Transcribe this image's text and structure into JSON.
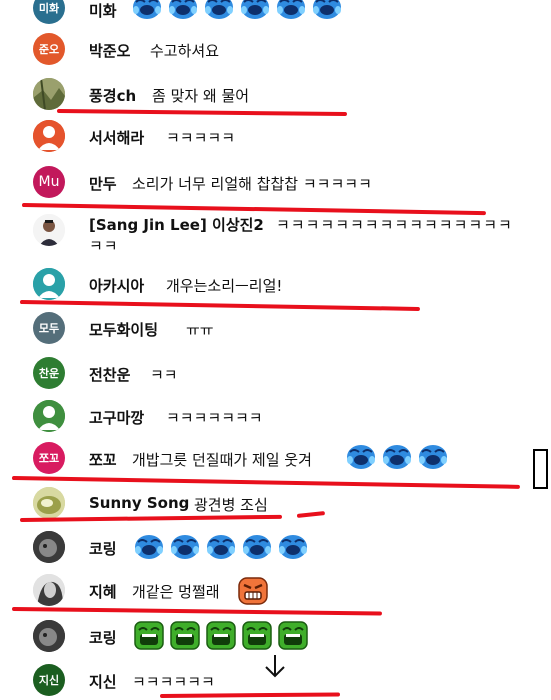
{
  "messages": [
    {
      "avatar_text": "미화",
      "name": "미화",
      "text": ""
    },
    {
      "avatar_text": "준오",
      "name": "박준오",
      "text": "수고하셔요"
    },
    {
      "avatar_text": "",
      "name": "풍경ch",
      "text": "좀 맞자 왜 물어"
    },
    {
      "avatar_text": "",
      "name": "서서해라",
      "text": "ㅋㅋㅋㅋㅋ"
    },
    {
      "avatar_text": "Mu",
      "name": "만두",
      "text": "소리가 너무 리얼해 찹찹찹 ㅋㅋㅋㅋㅋ"
    },
    {
      "avatar_text": "",
      "name": "[Sang Jin Lee] 이상진2",
      "text": "ㅋㅋㅋㅋㅋㅋㅋㅋㅋㅋㅋㅋㅋㅋㅋㅋ",
      "text_cont": "ㅋㅋ"
    },
    {
      "avatar_text": "",
      "name": "아카시아",
      "text": "개우는소리ㅡ리얼!"
    },
    {
      "avatar_text": "모두",
      "name": "모두화이팅",
      "text": "ㅠㅠ"
    },
    {
      "avatar_text": "찬운",
      "name": "전찬운",
      "text": "ㅋㅋ"
    },
    {
      "avatar_text": "",
      "name": "고구마깡",
      "text": "ㅋㅋㅋㅋㅋㅋㅋ"
    },
    {
      "avatar_text": "쪼꼬",
      "name": "쪼꼬",
      "text": "개밥그릇 던질때가 제일 웃겨"
    },
    {
      "avatar_text": "",
      "name": "Sunny Song",
      "text": "광견병 조심"
    },
    {
      "avatar_text": "",
      "name": "코링",
      "text": ""
    },
    {
      "avatar_text": "",
      "name": "지혜",
      "text": "개같은 멍쩔래"
    },
    {
      "avatar_text": "",
      "name": "코링",
      "text": ""
    },
    {
      "avatar_text": "지신",
      "name": "지신",
      "text": "ㅋㅋㅋㅋㅋㅋ"
    }
  ],
  "colors": {
    "annotation_red": "#e8101c",
    "avatar_mihwa": "#2a6f8f",
    "avatar_junoh": "#e2582b",
    "avatar_mandu": "#c2185b",
    "avatar_akasia": "#2aa1a8",
    "avatar_modu": "#546e7a",
    "avatar_chanun": "#2e7d32",
    "avatar_jjokko": "#d81b60",
    "avatar_jisin": "#1b5e20"
  }
}
